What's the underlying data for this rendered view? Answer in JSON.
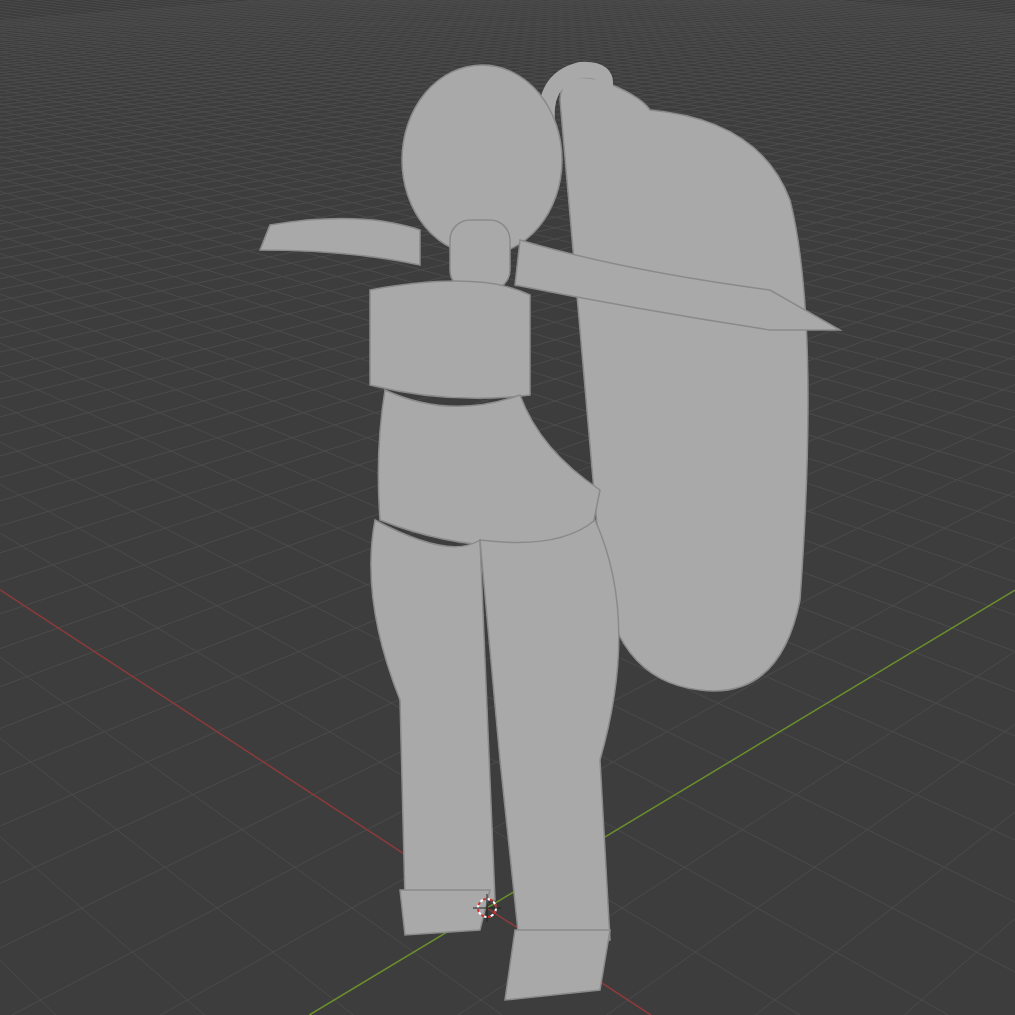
{
  "axes": [
    {
      "kind": "x",
      "color": "#8e3a3a"
    },
    {
      "kind": "y",
      "color": "#6a8f2c"
    }
  ],
  "cursor": {
    "visible": true
  }
}
